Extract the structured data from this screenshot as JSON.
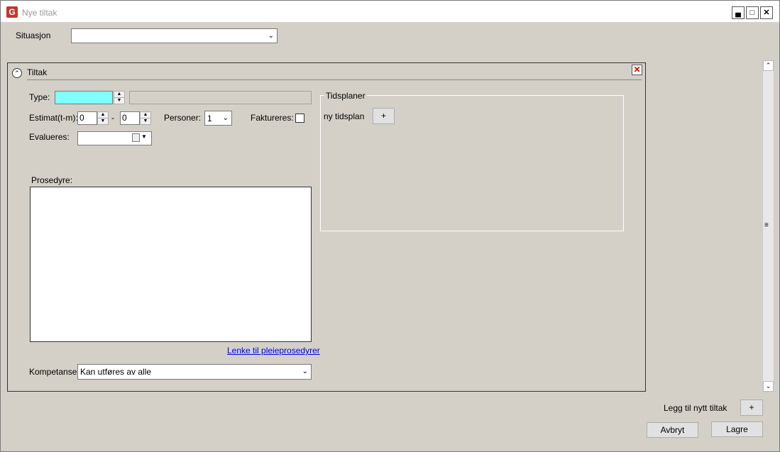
{
  "window": {
    "title": "Nye tiltak",
    "app_icon": "G"
  },
  "situation": {
    "label": "Situasjon",
    "value": ""
  },
  "panel": {
    "title": "Tiltak",
    "type_label": "Type:",
    "estimat_label": "Estimat(t-m):",
    "estimat_from": "0",
    "estimat_sep": "-",
    "estimat_to": "0",
    "personer_label": "Personer:",
    "personer_value": "1",
    "faktureres_label": "Faktureres:",
    "evalueres_label": "Evalueres:",
    "prosedyre_label": "Prosedyre:",
    "link_label": "Lenke til pleieprosedyrer",
    "kompetanse_label": "Kompetanse:",
    "kompetanse_value": "Kan utføres av alle"
  },
  "tidsplaner": {
    "title": "Tidsplaner",
    "ny_tidsplan_label": "ny tidsplan",
    "add_label": "+"
  },
  "footer": {
    "add_label": "Legg til nytt tiltak",
    "add_button": "+",
    "cancel": "Avbryt",
    "save": "Lagre"
  },
  "colors": {
    "type_input_bg": "#80ffff",
    "link": "#0000ee"
  }
}
